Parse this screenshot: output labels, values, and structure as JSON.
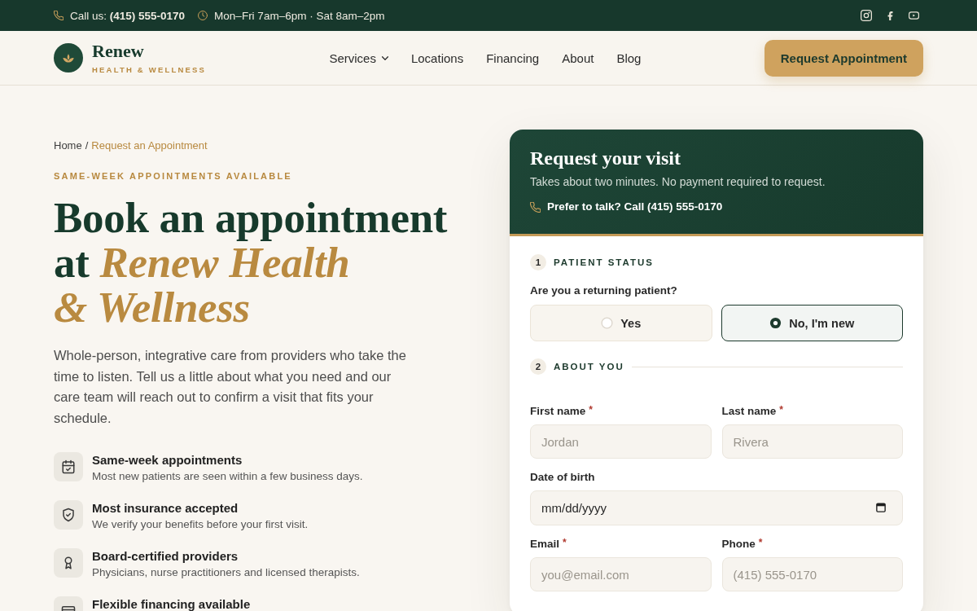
{
  "top_bar": {
    "phone": "Call us: **(415) 555-0170**",
    "hours": "Mon–Fri 7am–6pm · Sat 8am–2pm"
  },
  "header": {
    "brand": {
      "name": "Renew",
      "tagline": "HEALTH & WELLNESS"
    },
    "nav": [
      {
        "label": "Services",
        "dropdown": true
      },
      {
        "label": "Locations",
        "dropdown": false
      },
      {
        "label": "Financing",
        "dropdown": false
      },
      {
        "label": "About",
        "dropdown": false
      },
      {
        "label": "Blog",
        "dropdown": false
      }
    ],
    "cta": "Request Appointment"
  },
  "hero": {
    "breadcrumb": [
      {
        "label": "Home",
        "current": false
      },
      {
        "label": "Request an Appointment",
        "current": true
      }
    ],
    "breadcrumb_separator": "/",
    "eyebrow": "SAME-WEEK APPOINTMENTS AVAILABLE",
    "heading_lines": [
      "Book an appointment",
      "at *Renew Health*",
      "*& Wellness*"
    ],
    "intro": "Whole-person, integrative care from providers who take the time to listen. Tell us a little about what you need and our care team will reach out to confirm a visit that fits your schedule.",
    "features": [
      {
        "kind": "calendar",
        "title": "Same-week appointments",
        "description": "Most new patients are seen within a few business days."
      },
      {
        "kind": "shield",
        "title": "Most insurance accepted",
        "description": "We verify your benefits before your first visit."
      },
      {
        "kind": "award",
        "title": "Board-certified providers",
        "description": "Physicians, nurse practitioners and licensed therapists."
      },
      {
        "kind": "card",
        "title": "Flexible financing available"
      }
    ]
  },
  "form": {
    "title": "Request your visit",
    "subtitle": "Takes about two minutes. No payment required to request.",
    "call_prompt": "Prefer to talk? Call (415) 555-0170",
    "required_mark": "*",
    "sections": [
      {
        "number": "1",
        "title": "PATIENT STATUS",
        "divider": false,
        "question": "Are you a returning patient?",
        "options": [
          {
            "label": "Yes",
            "selected": false
          },
          {
            "label": "No, I'm new",
            "selected": true
          }
        ]
      },
      {
        "number": "2",
        "title": "ABOUT YOU",
        "divider": true,
        "rows": [
          [
            {
              "kind": "text",
              "label": "First name",
              "required": true,
              "placeholder": "Jordan"
            },
            {
              "kind": "text",
              "label": "Last name",
              "required": true,
              "placeholder": "Rivera"
            }
          ],
          [
            {
              "kind": "date",
              "label": "Date of birth",
              "required": false,
              "placeholder": "mm/dd/yyyy"
            }
          ],
          [
            {
              "kind": "email",
              "label": "Email",
              "required": true,
              "placeholder": "you@email.com"
            },
            {
              "kind": "tel",
              "label": "Phone",
              "required": true,
              "placeholder": "(415) 555-0170"
            }
          ]
        ]
      }
    ]
  }
}
